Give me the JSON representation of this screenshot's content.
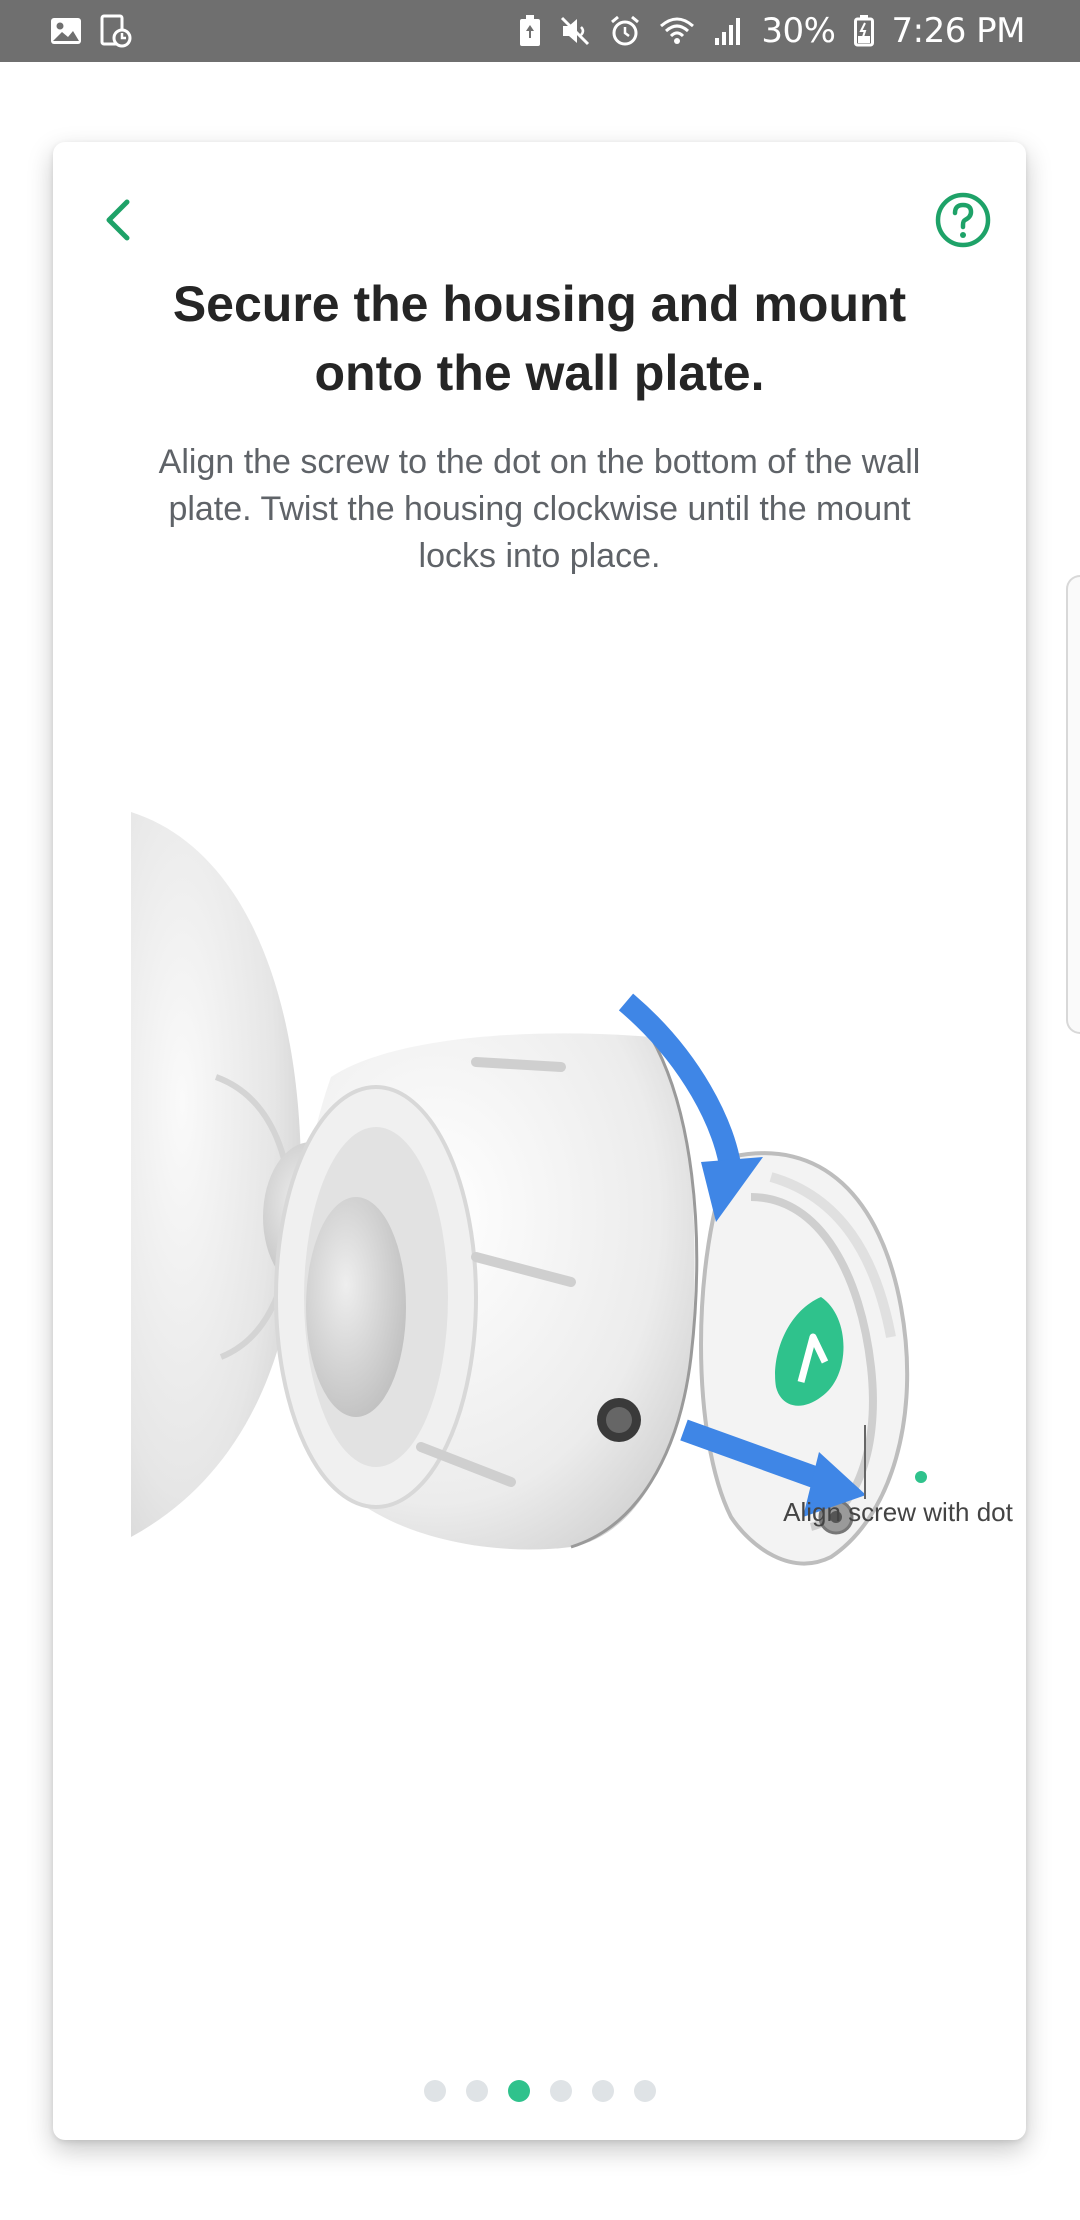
{
  "status_bar": {
    "battery_percent": "30%",
    "time": "7:26 PM",
    "left_icons": [
      "gallery-icon",
      "screen-recorder-icon"
    ],
    "right_icons": [
      "battery-saver-icon",
      "mute-icon",
      "alarm-icon",
      "wifi-icon",
      "signal-icon",
      "battery-icon"
    ]
  },
  "header": {
    "back_icon": "chevron-left-icon",
    "help_icon": "help-circle-icon"
  },
  "content": {
    "title": "Secure the housing and mount onto the wall plate.",
    "description": "Align the screw to the dot on the bottom of the wall plate. Twist the housing clockwise until the mount locks into place.",
    "callout": "Align screw with dot"
  },
  "pager": {
    "total": 6,
    "current": 3
  },
  "colors": {
    "accent_green": "#1ea268",
    "pager_active": "#2fc28c",
    "arrow_blue": "#3f86e6",
    "status_bar": "#6f6f6f"
  }
}
